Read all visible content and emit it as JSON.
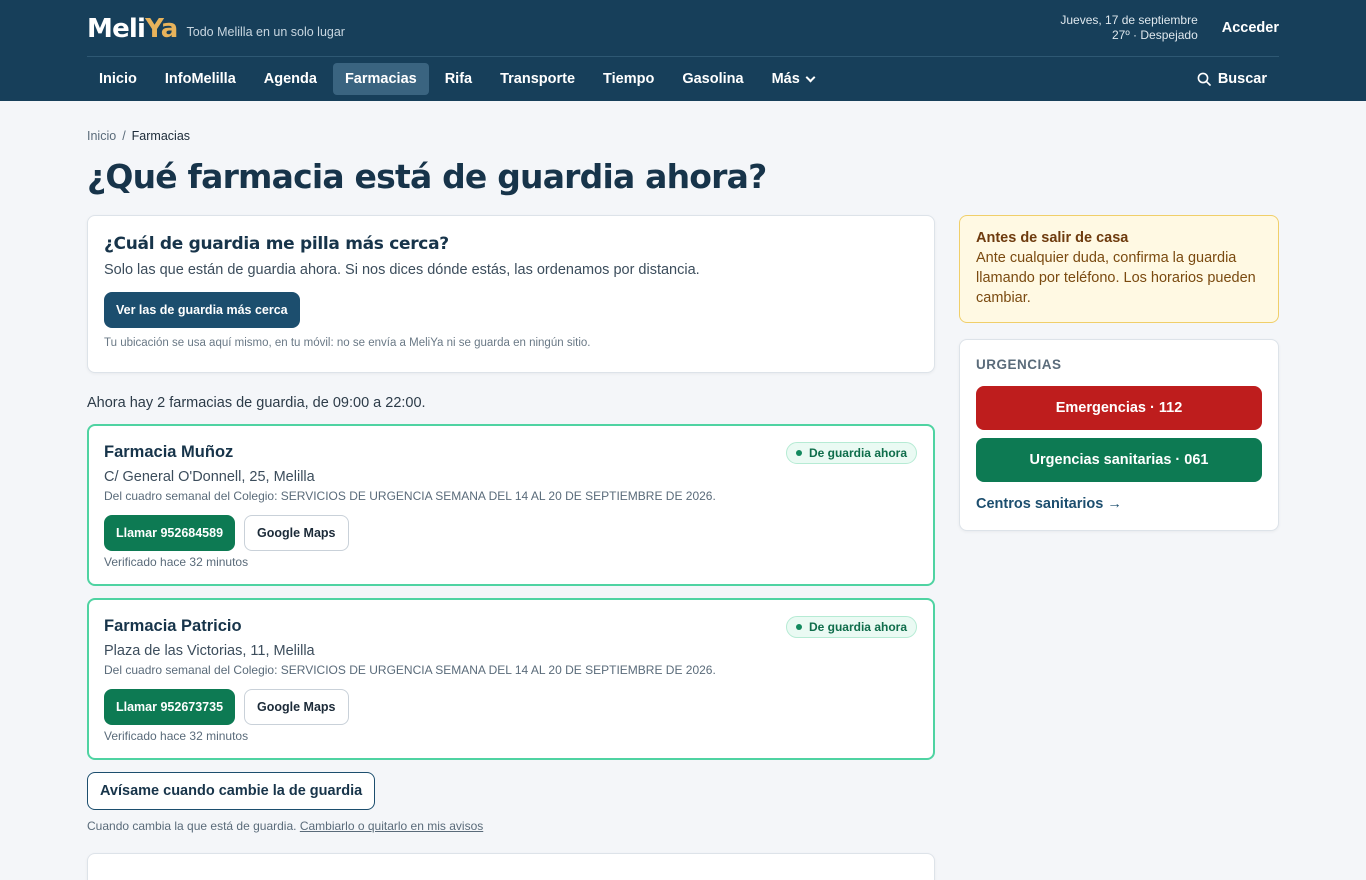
{
  "header": {
    "logo_part1": "Meli",
    "logo_part2": "Ya",
    "tagline": "Todo Melilla en un solo lugar",
    "date": "Jueves, 17 de septiembre",
    "weather": "27º · Despejado",
    "login": "Acceder",
    "logo_colors": {
      "primary": "#ffffff",
      "accent": "#e8b35b"
    }
  },
  "nav": {
    "items": [
      {
        "label": "Inicio"
      },
      {
        "label": "InfoMelilla"
      },
      {
        "label": "Agenda"
      },
      {
        "label": "Farmacias",
        "active": true
      },
      {
        "label": "Rifa"
      },
      {
        "label": "Transporte"
      },
      {
        "label": "Tiempo"
      },
      {
        "label": "Gasolina"
      },
      {
        "label": "Más",
        "dropdown": true
      }
    ],
    "search": "Buscar"
  },
  "breadcrumb": {
    "home": "Inicio",
    "separator": "/",
    "current": "Farmacias"
  },
  "page_title": "¿Qué farmacia está de guardia ahora?",
  "near_card": {
    "title": "¿Cuál de guardia me pilla más cerca?",
    "description": "Solo las que están de guardia ahora. Si nos dices dónde estás, las ordenamos por distancia.",
    "button": "Ver las de guardia más cerca",
    "privacy_note": "Tu ubicación se usa aquí mismo, en tu móvil: no se envía a MeliYa ni se guarda en ningún sitio."
  },
  "summary": "Ahora hay 2 farmacias de guardia, de 09:00 a 22:00.",
  "pharmacies": [
    {
      "name": "Farmacia Muñoz",
      "badge": "De guardia ahora",
      "address": "C/ General O'Donnell, 25, Melilla",
      "source": "Del cuadro semanal del Colegio: SERVICIOS DE URGENCIA SEMANA DEL 14 AL 20 DE SEPTIEMBRE DE 2026.",
      "call": "Llamar 952684589",
      "maps": "Google Maps",
      "verified": "Verificado hace 32 minutos"
    },
    {
      "name": "Farmacia Patricio",
      "badge": "De guardia ahora",
      "address": "Plaza de las Victorias, 11, Melilla",
      "source": "Del cuadro semanal del Colegio: SERVICIOS DE URGENCIA SEMANA DEL 14 AL 20 DE SEPTIEMBRE DE 2026.",
      "call": "Llamar 952673735",
      "maps": "Google Maps",
      "verified": "Verificado hace 32 minutos"
    }
  ],
  "alerts": {
    "button": "Avísame cuando cambie la de guardia",
    "note": "Cuando cambia la que está de guardia.",
    "link": "Cambiarlo o quitarlo en mis avisos"
  },
  "warning": {
    "title": "Antes de salir de casa",
    "text": "Ante cualquier duda, confirma la guardia llamando por teléfono. Los horarios pueden cambiar."
  },
  "urgencias": {
    "title": "URGENCIAS",
    "emergency": "Emergencias · 112",
    "sanitary": "Urgencias sanitarias · 061",
    "centers": "Centros sanitarios →"
  },
  "colors": {
    "header_bg": "#173f5a",
    "primary_button": "#1c4e6e",
    "call_green": "#0d7a53",
    "emergency_red": "#be1d1d",
    "pharmacy_border": "#4fd3a2",
    "warning_bg": "#fff9e3"
  }
}
